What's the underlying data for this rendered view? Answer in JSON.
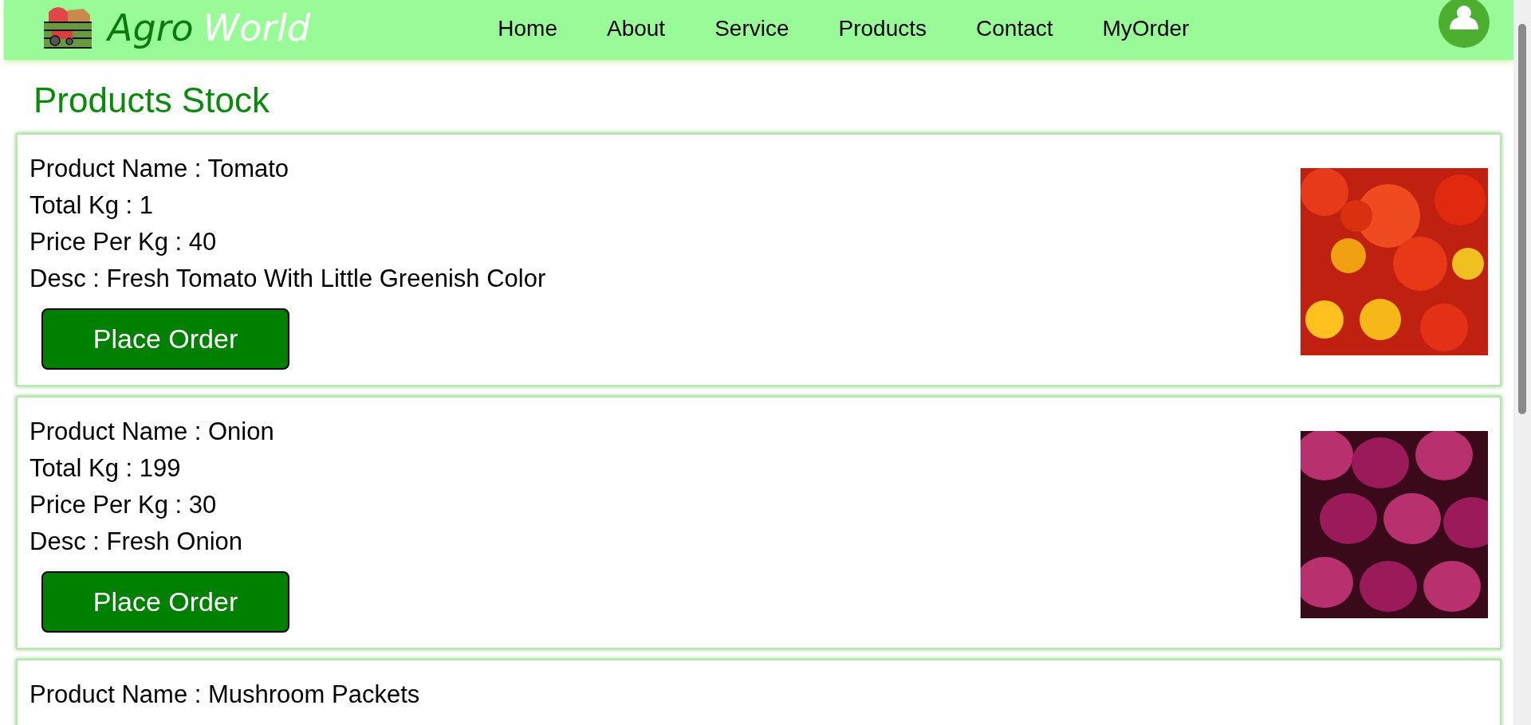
{
  "brand": {
    "first": "Agro",
    "second": "World"
  },
  "nav": [
    {
      "label": "Home"
    },
    {
      "label": "About"
    },
    {
      "label": "Service"
    },
    {
      "label": "Products"
    },
    {
      "label": "Contact"
    },
    {
      "label": "MyOrder"
    }
  ],
  "title": "Products Stock",
  "products": [
    {
      "lines": [
        "Product Name : Tomato",
        "Total Kg : 1",
        "Price Per Kg : 40",
        "Desc : Fresh Tomato With Little Greenish Color"
      ],
      "button": "Place Order"
    },
    {
      "lines": [
        "Product Name : Onion",
        "Total Kg : 199",
        "Price Per Kg : 30",
        "Desc : Fresh Onion"
      ],
      "button": "Place Order"
    },
    {
      "lines": [
        "Product Name : Mushroom Packets"
      ]
    }
  ]
}
